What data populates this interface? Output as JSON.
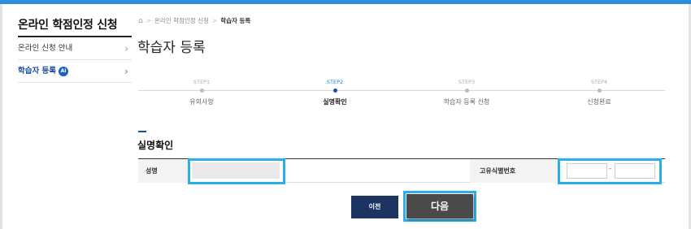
{
  "colors": {
    "accent": "#2a8fd8",
    "navy": "#1d3463",
    "highlight": "#29b0e8",
    "active_text": "#1a4fa0"
  },
  "sidebar": {
    "title": "온라인 학점인정 신청",
    "items": [
      {
        "label": "온라인 신청 안내",
        "active": false
      },
      {
        "label": "학습자 등록",
        "badge": "AI",
        "active": true
      }
    ]
  },
  "breadcrumb": {
    "home_icon": "home-icon",
    "items": [
      "온라인 학점인정 신청",
      "학습자 등록"
    ]
  },
  "page_title": "학습자 등록",
  "steps": [
    {
      "num": "STEP1",
      "name": "유의사항",
      "active": false
    },
    {
      "num": "STEP2",
      "name": "실명확인",
      "active": true
    },
    {
      "num": "STEP3",
      "name": "학습자 등록 신청",
      "active": false
    },
    {
      "num": "STEP4",
      "name": "신청완료",
      "active": false
    }
  ],
  "section_title": "실명확인",
  "form": {
    "name_label": "성명",
    "name_value": "",
    "id_label": "고유식별번호",
    "id_part1": "",
    "id_part2": "",
    "id_separator": "-"
  },
  "buttons": {
    "prev": "이전",
    "next": "다음"
  }
}
